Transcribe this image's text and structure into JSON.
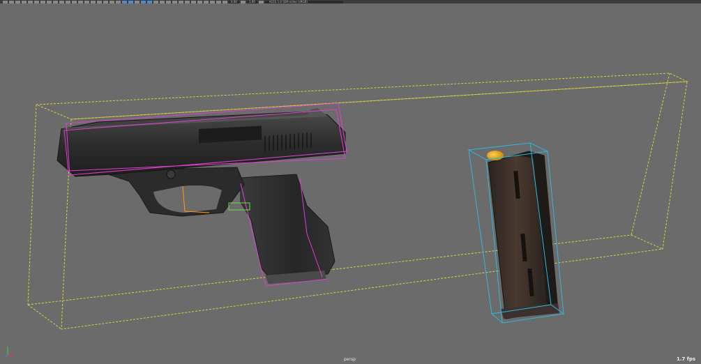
{
  "toolbar": {
    "field1": "0.00",
    "field2": "1.00",
    "color_space": "ACES 1.0 SDR-video (sRGB)"
  },
  "viewport": {
    "camera_label": "persp",
    "fps": "1.7 fps",
    "colors": {
      "background": "#6b6b6b",
      "group_bbox": "#d8d33a",
      "pistol_bbox": "#e040d0",
      "magazine_bbox": "#2fb8e0",
      "selection_orange": "#ff9a1a",
      "selection_green": "#6de04a"
    },
    "icons": [
      "axis-gizmo-icon"
    ]
  }
}
